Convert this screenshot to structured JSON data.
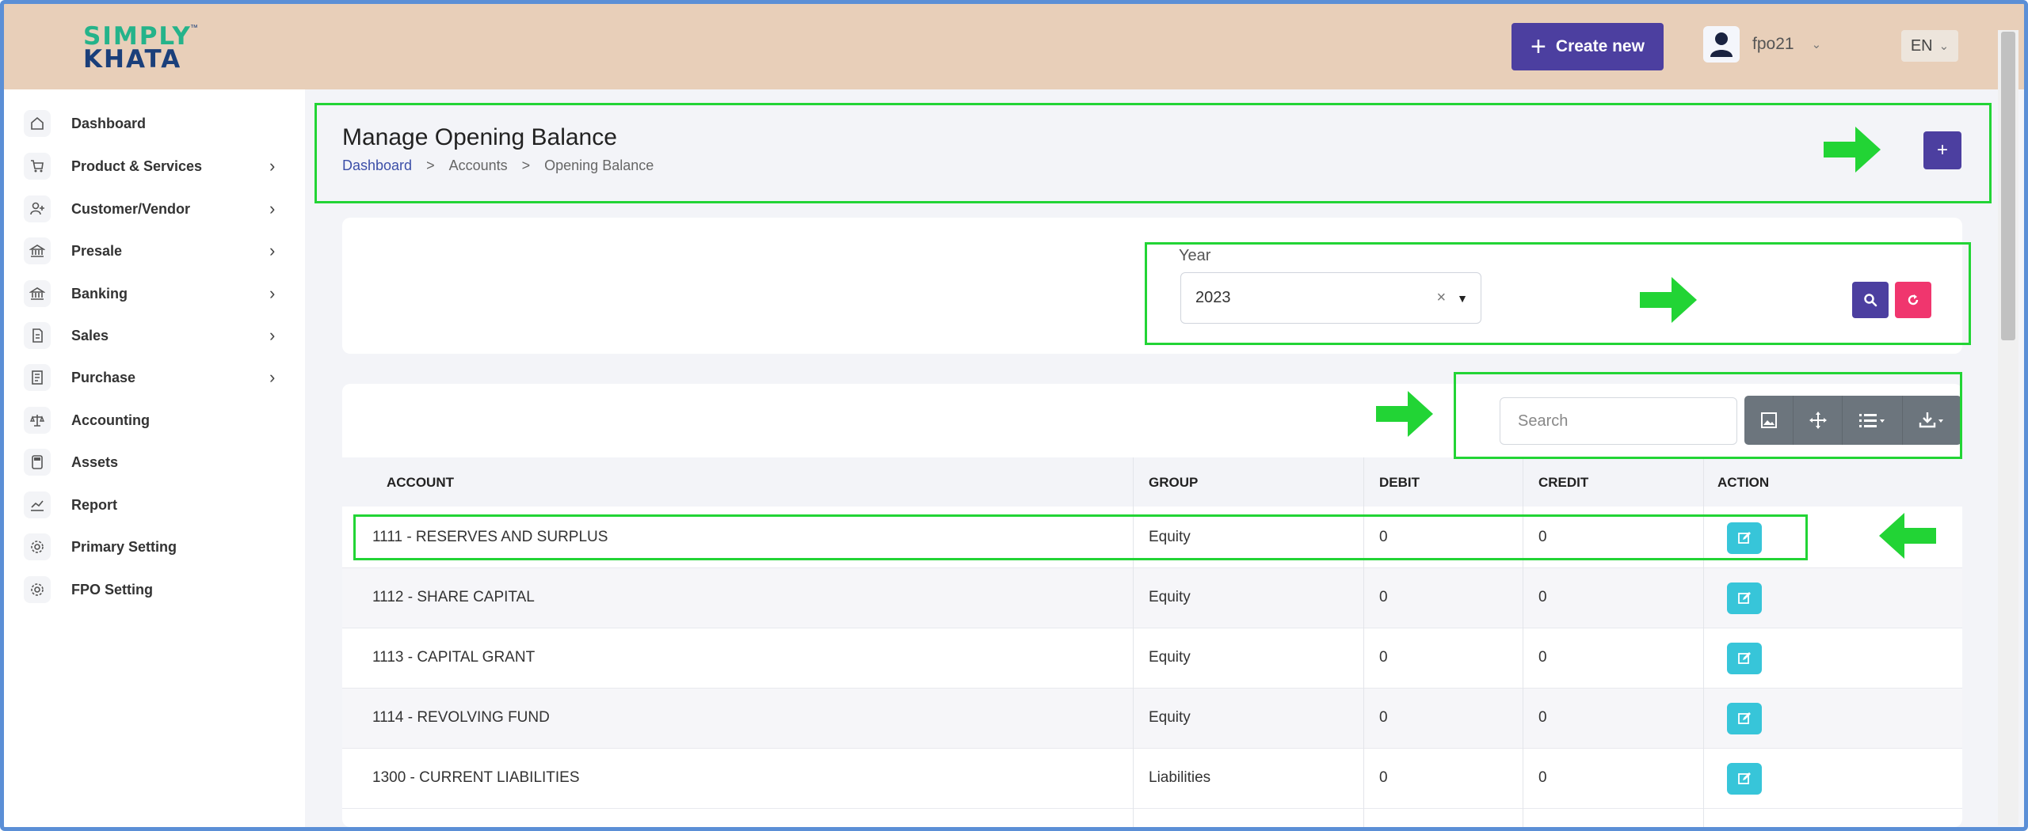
{
  "header": {
    "logo_line1": "SIMPLY",
    "logo_line2": "KHATA",
    "logo_tm": "™",
    "create_label": "Create new",
    "user_name": "fpo21",
    "lang": "EN"
  },
  "sidebar": {
    "items": [
      {
        "label": "Dashboard",
        "icon": "home-icon",
        "has_children": false
      },
      {
        "label": "Product & Services",
        "icon": "cart-icon",
        "has_children": true
      },
      {
        "label": "Customer/Vendor",
        "icon": "user-add-icon",
        "has_children": true
      },
      {
        "label": "Presale",
        "icon": "bank-icon",
        "has_children": true
      },
      {
        "label": "Banking",
        "icon": "bank-icon",
        "has_children": true
      },
      {
        "label": "Sales",
        "icon": "document-icon",
        "has_children": true
      },
      {
        "label": "Purchase",
        "icon": "receipt-icon",
        "has_children": true
      },
      {
        "label": "Accounting",
        "icon": "scale-icon",
        "has_children": false
      },
      {
        "label": "Assets",
        "icon": "calculator-icon",
        "has_children": false
      },
      {
        "label": "Report",
        "icon": "chart-icon",
        "has_children": false
      },
      {
        "label": "Primary Setting",
        "icon": "gear-icon",
        "has_children": false
      },
      {
        "label": "FPO Setting",
        "icon": "gear-icon",
        "has_children": false
      }
    ]
  },
  "page": {
    "title": "Manage Opening Balance",
    "breadcrumb": [
      "Dashboard",
      "Accounts",
      "Opening Balance"
    ],
    "breadcrumb_sep": ">",
    "add_label": "+"
  },
  "filter": {
    "year_label": "Year",
    "year_value": "2023",
    "clear_glyph": "×"
  },
  "table": {
    "search_placeholder": "Search",
    "columns": [
      "ACCOUNT",
      "GROUP",
      "DEBIT",
      "CREDIT",
      "ACTION"
    ],
    "rows": [
      {
        "account": "1111 - RESERVES AND SURPLUS",
        "group": "Equity",
        "debit": "0",
        "credit": "0"
      },
      {
        "account": "1112 - SHARE CAPITAL",
        "group": "Equity",
        "debit": "0",
        "credit": "0"
      },
      {
        "account": "1113 - CAPITAL GRANT",
        "group": "Equity",
        "debit": "0",
        "credit": "0"
      },
      {
        "account": "1114 - REVOLVING FUND",
        "group": "Equity",
        "debit": "0",
        "credit": "0"
      },
      {
        "account": "1300 - CURRENT LIABILITIES",
        "group": "Liabilities",
        "debit": "0",
        "credit": "0"
      }
    ]
  },
  "colors": {
    "primary": "#4c3fa0",
    "danger": "#f0366e",
    "info": "#37c5d9",
    "annotation": "#22d435",
    "header_bg": "#e8cfb9"
  }
}
